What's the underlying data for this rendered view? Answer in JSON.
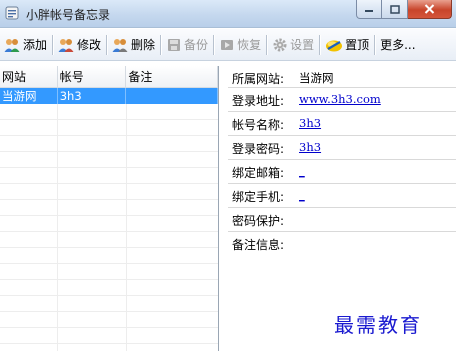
{
  "window": {
    "title": "小胖帐号备忘录"
  },
  "toolbar": {
    "add": "添加",
    "edit": "修改",
    "delete": "删除",
    "backup": "备份",
    "restore": "恢复",
    "settings": "设置",
    "pin": "置顶",
    "more": "更多..."
  },
  "list": {
    "headers": [
      "网站",
      "帐号",
      "备注"
    ],
    "rows": [
      {
        "site": "当游网",
        "account": "3h3",
        "note": ""
      }
    ]
  },
  "details": {
    "site": {
      "label": "所属网站:",
      "value": "当游网"
    },
    "url": {
      "label": "登录地址:",
      "value": "www.3h3.com"
    },
    "name": {
      "label": "帐号名称:",
      "value": "3h3"
    },
    "password": {
      "label": "登录密码:",
      "value": "3h3"
    },
    "email": {
      "label": "绑定邮箱:",
      "value": "_"
    },
    "phone": {
      "label": "绑定手机:",
      "value": "_"
    },
    "protect": {
      "label": "密码保护:",
      "value": ""
    },
    "note": {
      "label": "备注信息:",
      "value": ""
    }
  },
  "watermark": "最需教育",
  "colors": {
    "selection": "#3399ff",
    "link": "#0000cc",
    "close_button": "#c8452b"
  }
}
